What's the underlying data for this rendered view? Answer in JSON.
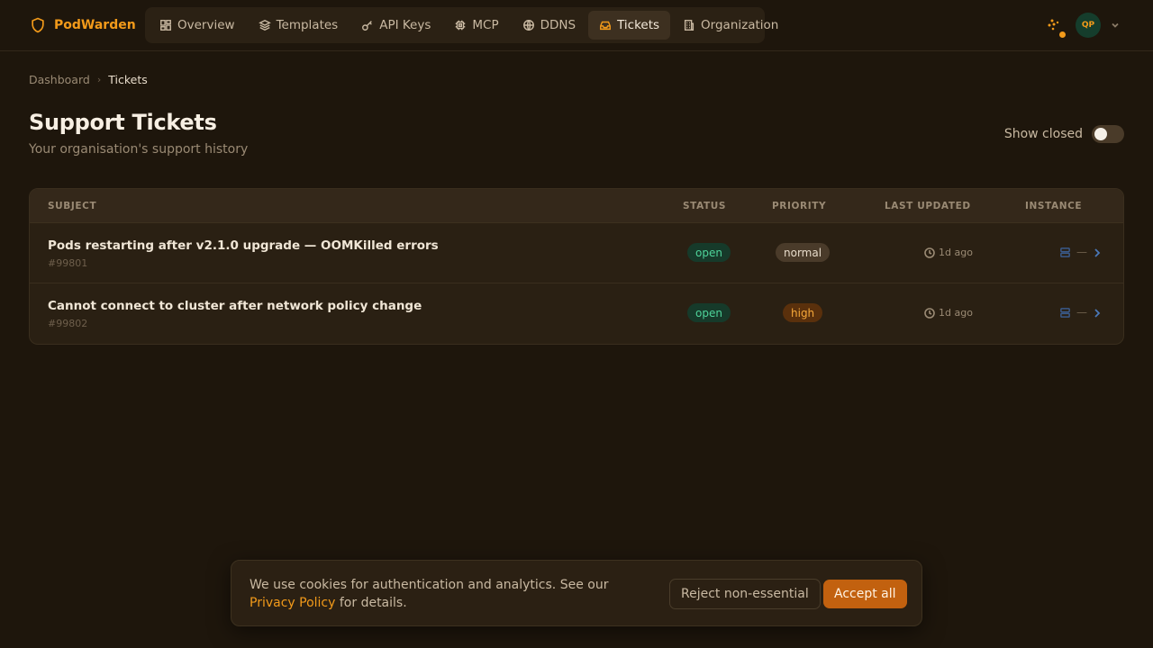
{
  "brand": {
    "name": "PodWarden",
    "icon": "shield-icon"
  },
  "nav": [
    {
      "label": "Overview",
      "icon": "grid-icon",
      "active": false
    },
    {
      "label": "Templates",
      "icon": "layers-icon",
      "active": false
    },
    {
      "label": "API Keys",
      "icon": "key-icon",
      "active": false
    },
    {
      "label": "MCP",
      "icon": "chip-icon",
      "active": false
    },
    {
      "label": "DDNS",
      "icon": "globe-icon",
      "active": false
    },
    {
      "label": "Tickets",
      "icon": "inbox-icon",
      "active": true
    },
    {
      "label": "Organization",
      "icon": "building-icon",
      "active": false
    }
  ],
  "user": {
    "initials": "QP"
  },
  "breadcrumb": {
    "parent": "Dashboard",
    "current": "Tickets"
  },
  "page": {
    "title": "Support Tickets",
    "subtitle": "Your organisation's support history"
  },
  "toggle": {
    "label": "Show closed",
    "on": false
  },
  "table": {
    "headers": {
      "subject": "SUBJECT",
      "status": "STATUS",
      "priority": "PRIORITY",
      "updated": "LAST UPDATED",
      "instance": "INSTANCE"
    },
    "rows": [
      {
        "subject": "Pods restarting after v2.1.0 upgrade — OOMKilled errors",
        "id": "#99801",
        "status": "open",
        "priority": "normal",
        "updated": "1d ago",
        "instance": "—"
      },
      {
        "subject": "Cannot connect to cluster after network policy change",
        "id": "#99802",
        "status": "open",
        "priority": "high",
        "updated": "1d ago",
        "instance": "—"
      }
    ]
  },
  "cookie": {
    "text_before": "We use cookies for authentication and analytics. See our ",
    "link": "Privacy Policy",
    "text_after": " for details.",
    "reject_label": "Reject non-essential",
    "accept_label": "Accept all"
  },
  "colors": {
    "accent": "#f29a1a",
    "background": "#1e160c",
    "open": "#4ed49a",
    "high": "#f7a93a"
  }
}
